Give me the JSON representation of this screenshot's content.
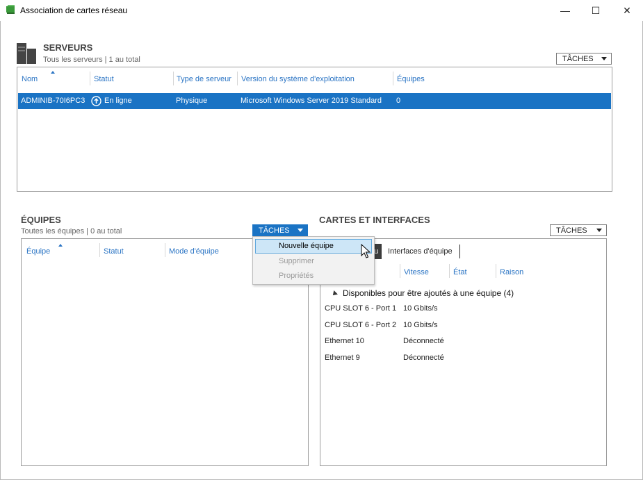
{
  "window": {
    "title": "Association de cartes réseau",
    "controls": {
      "minimize": "—",
      "maximize": "☐",
      "close": "✕"
    }
  },
  "servers": {
    "title": "SERVEURS",
    "subtitle": "Tous les serveurs | 1 au total",
    "tasks_label": "TÂCHES",
    "columns": [
      "Nom",
      "Statut",
      "Type de serveur",
      "Version du système d'exploitation",
      "Équipes"
    ],
    "rows": [
      {
        "name": "ADMINIB-70I6PC3",
        "status": "En ligne",
        "type": "Physique",
        "os": "Microsoft Windows Server 2019 Standard",
        "teams": "0"
      }
    ]
  },
  "teams": {
    "title": "ÉQUIPES",
    "subtitle": "Toutes les équipes | 0 au total",
    "tasks_label": "TÂCHES",
    "columns": [
      "Équipe",
      "Statut",
      "Mode d'équipe"
    ]
  },
  "tasks_menu": {
    "items": [
      "Nouvelle équipe",
      "Supprimer",
      "Propriétés"
    ]
  },
  "adapters": {
    "title": "CARTES ET INTERFACES",
    "tasks_label": "TÂCHES",
    "tab_partial": "u",
    "tab_interfaces": "Interfaces d'équipe",
    "columns": [
      "Vitesse",
      "État",
      "Raison"
    ],
    "group_label": "Disponibles pour être ajoutés à une équipe (4)",
    "rows": [
      {
        "name": "CPU SLOT 6 - Port 1",
        "speed": "10 Gbits/s"
      },
      {
        "name": "CPU SLOT 6 - Port 2",
        "speed": "10 Gbits/s"
      },
      {
        "name": "Ethernet 10",
        "speed": "Déconnecté"
      },
      {
        "name": "Ethernet 9",
        "speed": "Déconnecté"
      }
    ]
  },
  "colors": {
    "accent": "#1a73c4",
    "header_text": "#2a74c4"
  }
}
